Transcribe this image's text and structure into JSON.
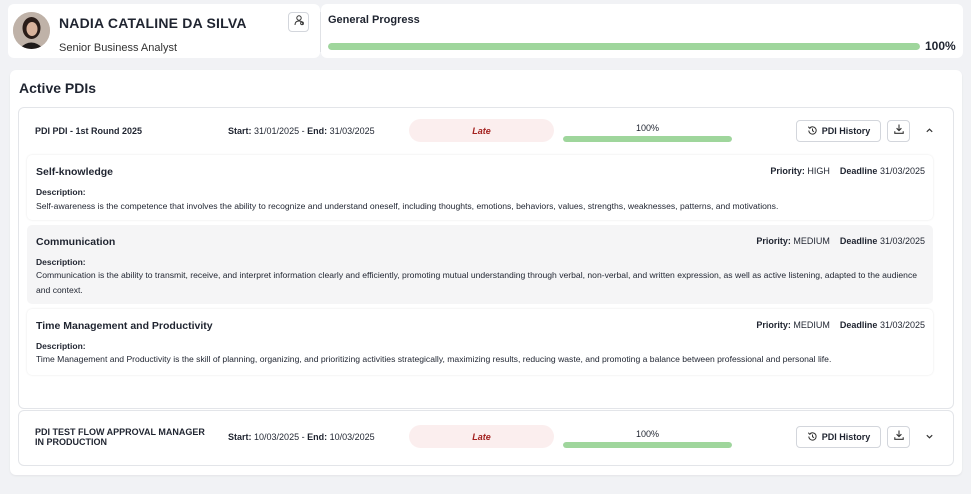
{
  "profile": {
    "name": "NADIA CATALINE DA SILVA",
    "role": "Senior Business Analyst",
    "avatar_icon": "person-photo",
    "profile_button_icon": "user-icon"
  },
  "general_progress": {
    "title": "General Progress",
    "value": 1.0,
    "value_label": "100%",
    "bar_color": "#9fd69c"
  },
  "active_pdis": {
    "title": "Active PDIs",
    "items": [
      {
        "name": "PDI PDI - 1st Round 2025",
        "start_label": "Start:",
        "start_date": "31/01/2025",
        "end_label": "End:",
        "end_date": "31/03/2025",
        "status": "Late",
        "progress": 1.0,
        "progress_label": "100%",
        "history_label": "PDI History",
        "expanded": true,
        "competencies": [
          {
            "title": "Self-knowledge",
            "priority_label": "Priority:",
            "priority": "HIGH",
            "deadline_label": "Deadline",
            "deadline": "31/03/2025",
            "description_label": "Description:",
            "description": "Self-awareness is the competence that involves the ability to recognize and understand oneself, including thoughts, emotions, behaviors, values, strengths, weaknesses, patterns, and motivations."
          },
          {
            "title": "Communication",
            "priority_label": "Priority:",
            "priority": "MEDIUM",
            "deadline_label": "Deadline",
            "deadline": "31/03/2025",
            "description_label": "Description:",
            "description": "Communication is the ability to transmit, receive, and interpret information clearly and efficiently, promoting mutual understanding through verbal, non-verbal, and written expression, as well as active listening, adapted to the audience and context."
          },
          {
            "title": "Time Management and Productivity",
            "priority_label": "Priority:",
            "priority": "MEDIUM",
            "deadline_label": "Deadline",
            "deadline": "31/03/2025",
            "description_label": "Description:",
            "description": "Time Management and Productivity is the skill of planning, organizing, and prioritizing activities strategically, maximizing results, reducing waste, and promoting a balance between professional and personal life."
          }
        ]
      },
      {
        "name_line1": "PDI TEST FLOW APPROVAL MANAGER",
        "name_line2": "IN PRODUCTION",
        "start_label": "Start:",
        "start_date": "10/03/2025",
        "end_label": "End:",
        "end_date": "10/03/2025",
        "status": "Late",
        "progress": 1.0,
        "progress_label": "100%",
        "history_label": "PDI History",
        "expanded": false
      }
    ]
  },
  "colors": {
    "late_bg": "#fbeeee",
    "late_text": "#a3211f",
    "progress_fill": "#9fd69c"
  }
}
